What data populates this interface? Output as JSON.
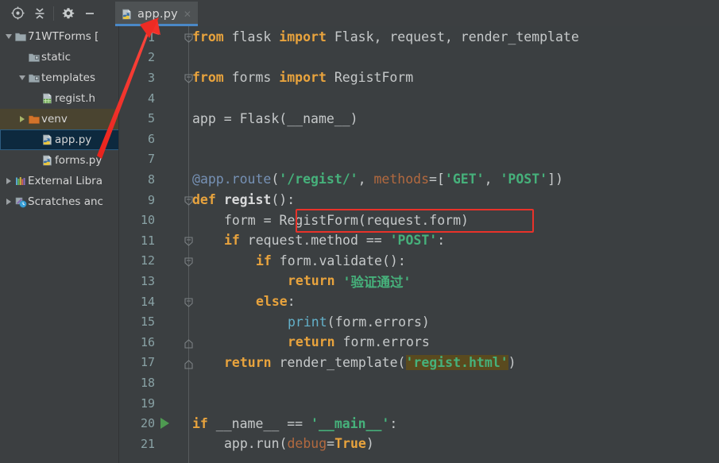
{
  "window": {
    "theme_bg": "#3c3f41",
    "editor_bg": "#3b3f41",
    "accent": "#4a88c7",
    "annotation_color": "#e8322a"
  },
  "toolbar": {
    "buttons": [
      {
        "name": "locate-in-project-icon",
        "tooltip": "Select Opened File"
      },
      {
        "name": "collapse-all-icon",
        "tooltip": "Collapse All"
      },
      {
        "name": "settings-gear-icon",
        "tooltip": "Settings"
      },
      {
        "name": "hide-panel-icon",
        "tooltip": "Hide"
      }
    ]
  },
  "tabs": [
    {
      "label": "app.py",
      "icon": "python-file-icon",
      "active": true,
      "close_glyph": "✕"
    }
  ],
  "project_tree": [
    {
      "label": "71WTForms [",
      "icon": "folder-icon",
      "twisty": "down",
      "indent": 0,
      "state": "normal"
    },
    {
      "label": "static",
      "icon": "folder-special-icon",
      "twisty": "none",
      "indent": 1,
      "state": "normal"
    },
    {
      "label": "templates",
      "icon": "folder-special-icon",
      "twisty": "down",
      "indent": 1,
      "state": "normal"
    },
    {
      "label": "regist.h",
      "icon": "html-file-icon",
      "twisty": "none",
      "indent": 2,
      "state": "normal"
    },
    {
      "label": "venv",
      "icon": "folder-orange-icon",
      "twisty": "right-green",
      "indent": 1,
      "state": "highlighted"
    },
    {
      "label": "app.py",
      "icon": "python-file-icon",
      "twisty": "none",
      "indent": 2,
      "state": "selected"
    },
    {
      "label": "forms.py",
      "icon": "python-file-icon",
      "twisty": "none",
      "indent": 2,
      "state": "normal"
    },
    {
      "label": "External Libra",
      "icon": "libraries-icon",
      "twisty": "right",
      "indent": 0,
      "state": "normal"
    },
    {
      "label": "Scratches anc",
      "icon": "scratches-icon",
      "twisty": "right",
      "indent": 0,
      "state": "normal"
    }
  ],
  "editor": {
    "line_numbers": [
      1,
      2,
      3,
      4,
      5,
      6,
      7,
      8,
      9,
      10,
      11,
      12,
      13,
      14,
      15,
      16,
      17,
      18,
      19,
      20,
      21
    ],
    "run_marker_line": 20,
    "fold_marker_lines": [
      1,
      3,
      9,
      11,
      12,
      14,
      16,
      17
    ],
    "lines": [
      {
        "n": 1,
        "indent": 0,
        "tokens": [
          {
            "t": "from",
            "c": "kw"
          },
          {
            "t": " flask ",
            "c": "pl"
          },
          {
            "t": "import",
            "c": "kw"
          },
          {
            "t": " Flask, request, render_template",
            "c": "pl"
          }
        ]
      },
      {
        "n": 2,
        "indent": 0,
        "tokens": []
      },
      {
        "n": 3,
        "indent": 0,
        "tokens": [
          {
            "t": "from",
            "c": "kw"
          },
          {
            "t": " forms ",
            "c": "pl"
          },
          {
            "t": "import",
            "c": "kw"
          },
          {
            "t": " RegistForm",
            "c": "pl"
          }
        ]
      },
      {
        "n": 4,
        "indent": 0,
        "tokens": []
      },
      {
        "n": 5,
        "indent": 0,
        "tokens": [
          {
            "t": "app = Flask(__name__)",
            "c": "pl"
          }
        ]
      },
      {
        "n": 6,
        "indent": 0,
        "tokens": []
      },
      {
        "n": 7,
        "indent": 0,
        "tokens": []
      },
      {
        "n": 8,
        "indent": 0,
        "tokens": [
          {
            "t": "@",
            "c": "decat"
          },
          {
            "t": "app.route",
            "c": "decat"
          },
          {
            "t": "(",
            "c": "pl"
          },
          {
            "t": "'/regist/'",
            "c": "str"
          },
          {
            "t": ", ",
            "c": "pl"
          },
          {
            "t": "methods",
            "c": "kwarg"
          },
          {
            "t": "=[",
            "c": "pl"
          },
          {
            "t": "'GET'",
            "c": "str"
          },
          {
            "t": ", ",
            "c": "pl"
          },
          {
            "t": "'POST'",
            "c": "str"
          },
          {
            "t": "])",
            "c": "pl"
          }
        ]
      },
      {
        "n": 9,
        "indent": 0,
        "tokens": [
          {
            "t": "def",
            "c": "kw"
          },
          {
            "t": " ",
            "c": "pl"
          },
          {
            "t": "regist",
            "c": "fn"
          },
          {
            "t": "():",
            "c": "pl"
          }
        ]
      },
      {
        "n": 10,
        "indent": 1,
        "tokens": [
          {
            "t": "form = RegistForm(request.form)",
            "c": "pl"
          }
        ]
      },
      {
        "n": 11,
        "indent": 1,
        "tokens": [
          {
            "t": "if",
            "c": "kw"
          },
          {
            "t": " request.method == ",
            "c": "pl"
          },
          {
            "t": "'POST'",
            "c": "str"
          },
          {
            "t": ":",
            "c": "pl"
          }
        ]
      },
      {
        "n": 12,
        "indent": 2,
        "tokens": [
          {
            "t": "if",
            "c": "kw"
          },
          {
            "t": " form.validate():",
            "c": "pl"
          }
        ]
      },
      {
        "n": 13,
        "indent": 3,
        "tokens": [
          {
            "t": "return",
            "c": "kw"
          },
          {
            "t": " ",
            "c": "pl"
          },
          {
            "t": "'验证通过'",
            "c": "str"
          }
        ]
      },
      {
        "n": 14,
        "indent": 2,
        "tokens": [
          {
            "t": "else",
            "c": "kw"
          },
          {
            "t": ":",
            "c": "pl"
          }
        ]
      },
      {
        "n": 15,
        "indent": 3,
        "tokens": [
          {
            "t": "print",
            "c": "bif"
          },
          {
            "t": "(form.errors)",
            "c": "pl"
          }
        ]
      },
      {
        "n": 16,
        "indent": 3,
        "tokens": [
          {
            "t": "return",
            "c": "kw"
          },
          {
            "t": " form.errors",
            "c": "pl"
          }
        ]
      },
      {
        "n": 17,
        "indent": 1,
        "tokens": [
          {
            "t": "return",
            "c": "kw"
          },
          {
            "t": " render_template(",
            "c": "pl"
          },
          {
            "t": "'regist.html'",
            "c": "hlstr"
          },
          {
            "t": ")",
            "c": "pl"
          }
        ]
      },
      {
        "n": 18,
        "indent": 0,
        "tokens": []
      },
      {
        "n": 19,
        "indent": 0,
        "tokens": []
      },
      {
        "n": 20,
        "indent": 0,
        "tokens": [
          {
            "t": "if",
            "c": "kw"
          },
          {
            "t": " __name__ == ",
            "c": "pl"
          },
          {
            "t": "'__main__'",
            "c": "str"
          },
          {
            "t": ":",
            "c": "pl"
          }
        ]
      },
      {
        "n": 21,
        "indent": 1,
        "tokens": [
          {
            "t": "app.run(",
            "c": "pl"
          },
          {
            "t": "debug",
            "c": "kwarg"
          },
          {
            "t": "=",
            "c": "pl"
          },
          {
            "t": "True",
            "c": "kw"
          },
          {
            "t": ")",
            "c": "pl"
          }
        ]
      }
    ]
  },
  "annotations": {
    "highlight_box": {
      "name": "registform-highlight-box",
      "target_text": "RegistForm(request.form)"
    },
    "arrow": {
      "name": "red-pointer-arrow",
      "points_to": "app.py tab"
    }
  }
}
